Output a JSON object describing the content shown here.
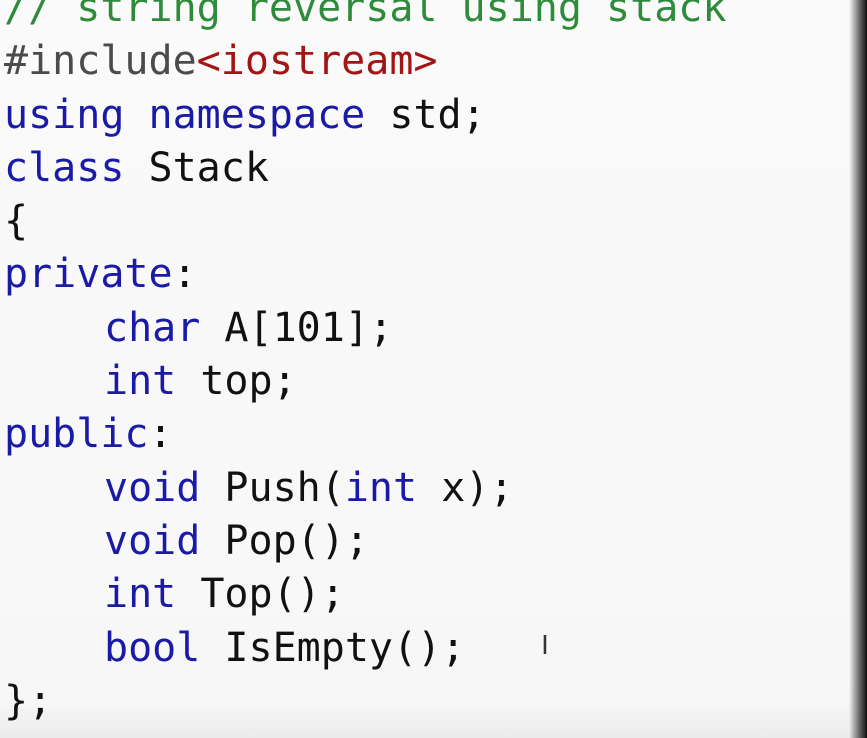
{
  "code": {
    "comment": "// string reversal using stack",
    "preproc_directive": "#include",
    "include_file": "<iostream>",
    "using_kw": "using",
    "namespace_kw": "namespace",
    "std_text": "std;",
    "class_kw": "class",
    "class_name": "Stack",
    "open_brace": "{",
    "private_kw": "private",
    "colon": ":",
    "char_kw": "char",
    "array_decl": "A[101];",
    "int_kw": "int",
    "top_decl": "top;",
    "public_kw": "public",
    "void_kw": "void",
    "push_decl_prefix": "Push(",
    "push_param": "x);",
    "pop_decl": "Pop();",
    "top_func_decl": "Top();",
    "bool_kw": "bool",
    "isempty_decl": "IsEmpty();",
    "close_brace": "};"
  },
  "cursor": {
    "glyph": "I"
  },
  "colors": {
    "keyword": "#1a1aa6",
    "comment": "#2e8b3a",
    "include_string": "#a31515",
    "text": "#111111",
    "background": "#fafafa"
  }
}
